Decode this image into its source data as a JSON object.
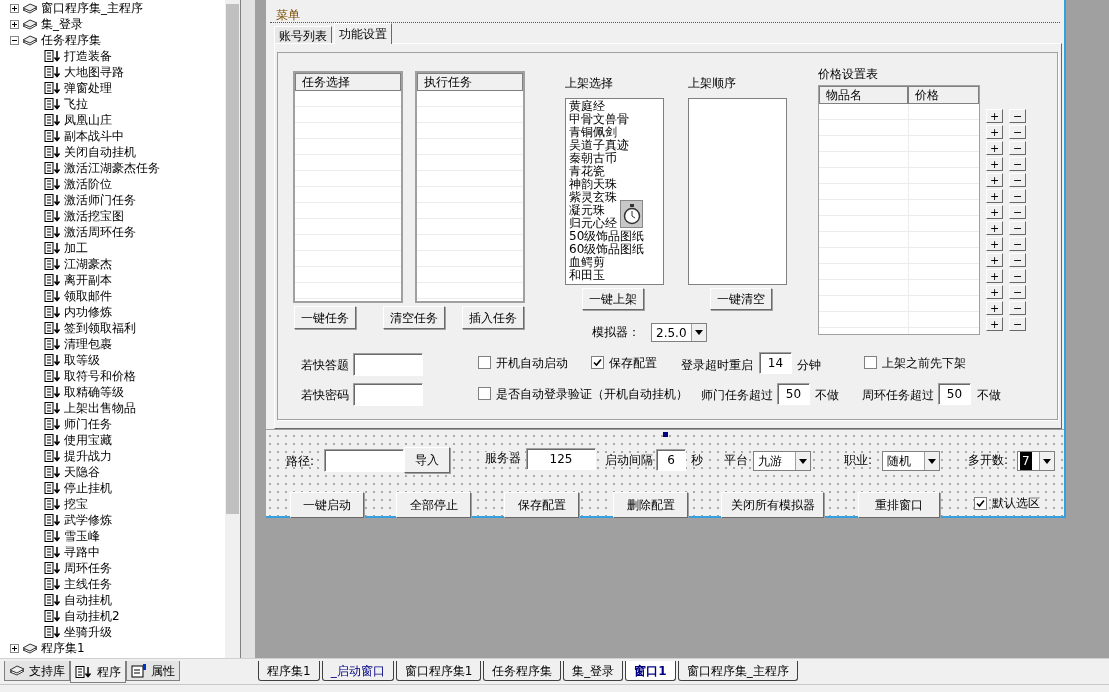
{
  "tree": [
    {
      "label": "窗口程序集_主程序",
      "expanded": false
    },
    {
      "label": "集_登录",
      "expanded": false
    },
    {
      "label": "任务程序集",
      "expanded": true,
      "children": [
        "打造装备",
        "大地图寻路",
        "弹窗处理",
        "飞拉",
        "凤凰山庄",
        "副本战斗中",
        "关闭自动挂机",
        "激活江湖豪杰任务",
        "激活阶位",
        "激活师门任务",
        "激活挖宝图",
        "激活周环任务",
        "加工",
        "江湖豪杰",
        "离开副本",
        "领取邮件",
        "内功修炼",
        "签到领取福利",
        "清理包裹",
        "取等级",
        "取符号和价格",
        "取精确等级",
        "上架出售物品",
        "师门任务",
        "使用宝藏",
        "提升战力",
        "天隐谷",
        "停止挂机",
        "挖宝",
        "武学修炼",
        "雪玉峰",
        "寻路中",
        "周环任务",
        "主线任务",
        "自动挂机",
        "自动挂机2",
        "坐骑升级"
      ]
    },
    {
      "label": "程序集1",
      "expanded": false
    }
  ],
  "panel_tabs": [
    {
      "label": "支持库",
      "selected": false,
      "kind": "library"
    },
    {
      "label": "程序",
      "selected": true,
      "kind": "program"
    },
    {
      "label": "属性",
      "selected": false,
      "kind": "property"
    }
  ],
  "form": {
    "menu": "菜单",
    "tabs": [
      {
        "label": "账号列表",
        "selected": false
      },
      {
        "label": "功能设置",
        "selected": true
      }
    ],
    "task_lists": [
      {
        "header": "任务选择"
      },
      {
        "header": "执行任务"
      }
    ],
    "task_buttons": [
      "一键任务",
      "清空任务",
      "插入任务"
    ],
    "shelf_select": {
      "label": "上架选择",
      "items": [
        "黄庭经",
        "甲骨文兽骨",
        "青铜佩剑",
        "吴道子真迹",
        "秦朝古币",
        "青花瓷",
        "神韵天珠",
        "紫灵玄珠",
        "凝元珠",
        "归元心经",
        "50级饰品图纸",
        "60级饰品图纸",
        "血鳄剪",
        "和田玉"
      ],
      "button": "一键上架"
    },
    "shelf_order": {
      "label": "上架顺序",
      "button": "一键清空"
    },
    "emulator": {
      "label": "模拟器：",
      "value": "2.5.0"
    },
    "price_table": {
      "title": "价格设置表",
      "columns": [
        "物品名",
        "价格"
      ],
      "plus": "+",
      "minus": "−"
    },
    "answer": {
      "label": "若快答题"
    },
    "password": {
      "label": "若快密码"
    },
    "checkboxes": [
      {
        "label": "开机自动启动",
        "checked": false
      },
      {
        "label": "保存配置",
        "checked": true
      },
      {
        "label": "上架之前先下架",
        "checked": false
      },
      {
        "label": "是否自动登录验证（开机自动挂机）",
        "checked": false
      }
    ],
    "login_timeout": {
      "label": "登录超时重启",
      "value": "14",
      "unit": "分钟"
    },
    "master_limit": {
      "label": "师门任务超过",
      "value": "50",
      "unit": "不做"
    },
    "cycle_limit": {
      "label": "周环任务超过",
      "value": "50",
      "unit": "不做"
    },
    "path": {
      "label": "路径:",
      "button": "导入"
    },
    "server": {
      "label": "服务器",
      "value": "125"
    },
    "interval": {
      "label": "启动间隔",
      "value": "6",
      "unit": "秒"
    },
    "platform": {
      "label": "平台",
      "value": "九游"
    },
    "job": {
      "label": "职业:",
      "value": "随机"
    },
    "multi": {
      "label": "多开数:",
      "value": "7"
    },
    "actions": [
      "一键启动",
      "全部停止",
      "保存配置",
      "删除配置",
      "关闭所有模拟器",
      "重排窗口"
    ],
    "default_area": {
      "label": "默认选区",
      "checked": true
    }
  },
  "doc_tabs": [
    {
      "label": "程序集1",
      "kind": "module",
      "selected": false
    },
    {
      "label": "_启动窗口",
      "kind": "window",
      "selected": false
    },
    {
      "label": "窗口程序集1",
      "kind": "module",
      "selected": false
    },
    {
      "label": "任务程序集",
      "kind": "module",
      "selected": false
    },
    {
      "label": "集_登录",
      "kind": "module",
      "selected": false
    },
    {
      "label": "窗口1",
      "kind": "window",
      "selected": true
    },
    {
      "label": "窗口程序集_主程序",
      "kind": "module",
      "selected": false
    }
  ]
}
